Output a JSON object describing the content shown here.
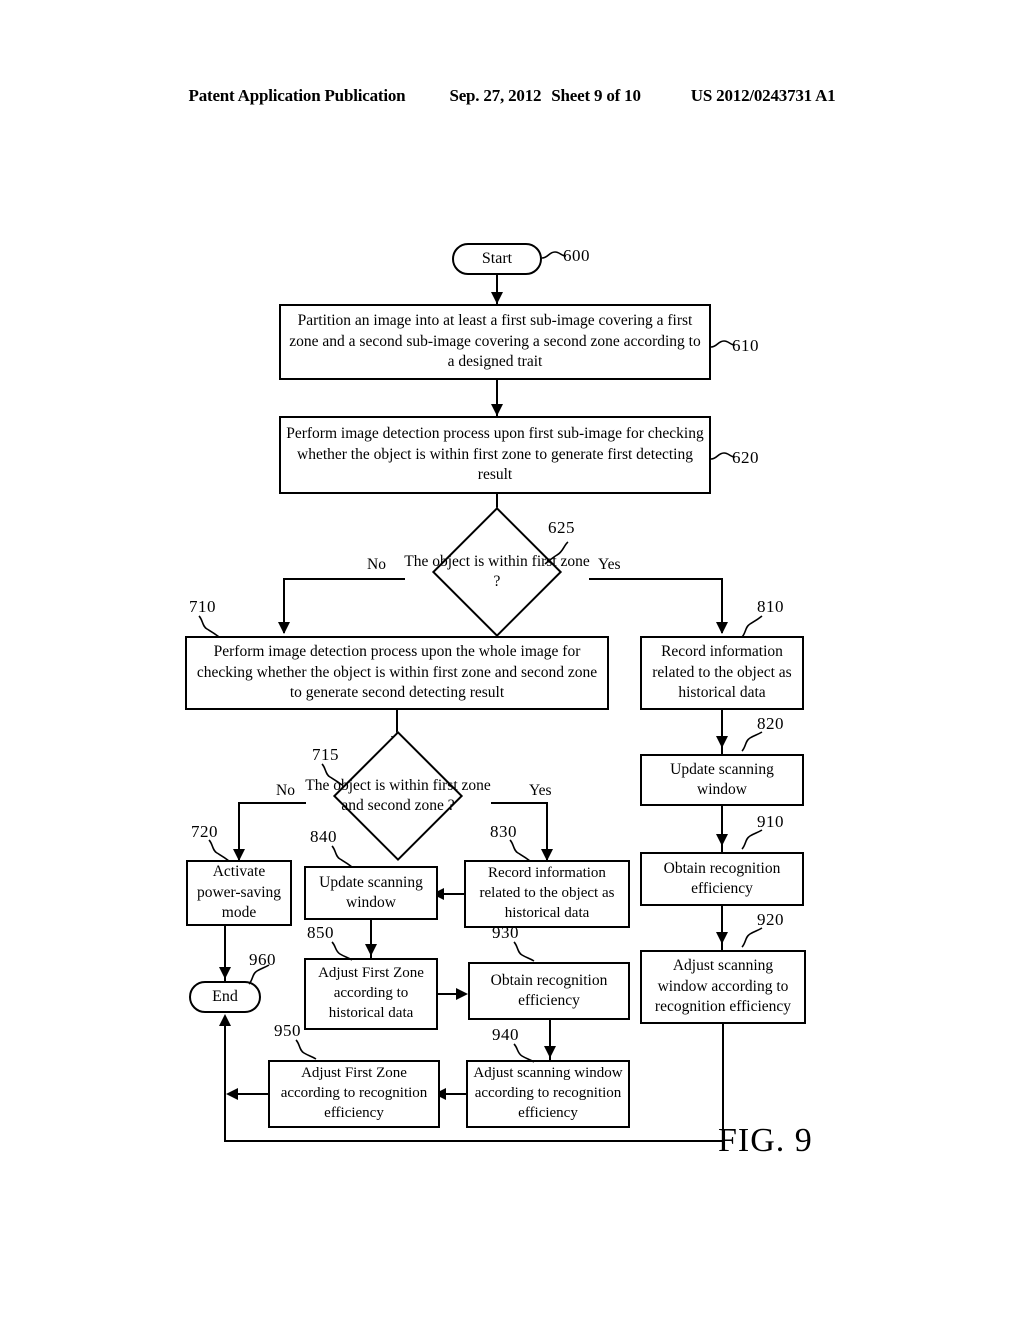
{
  "header": {
    "publication": "Patent Application Publication",
    "date": "Sep. 27, 2012",
    "sheet": "Sheet 9 of 10",
    "number": "US 2012/0243731 A1"
  },
  "figure": {
    "caption": "FIG. 9"
  },
  "nodes": {
    "start": {
      "label": "Start",
      "ref": "600"
    },
    "n610": {
      "label": "Partition an image into at least a first sub-image covering a first zone and a second sub-image covering a second zone according to a designed trait",
      "ref": "610"
    },
    "n620": {
      "label": "Perform image detection process upon first sub-image for checking whether the object is within first zone to generate first detecting result",
      "ref": "620"
    },
    "d625": {
      "label": "The object is within first zone ?",
      "ref": "625",
      "yes": "Yes",
      "no": "No"
    },
    "n710": {
      "label": "Perform image detection process upon the whole image for checking whether the object is within first zone and second zone to generate second detecting result",
      "ref": "710"
    },
    "n810": {
      "label": "Record information related to the object as historical data",
      "ref": "810"
    },
    "n820": {
      "label": "Update scanning window",
      "ref": "820"
    },
    "n910": {
      "label": "Obtain recognition efficiency",
      "ref": "910"
    },
    "n920": {
      "label": "Adjust scanning window according to recognition efficiency",
      "ref": "920"
    },
    "d715": {
      "label": "The object is within first zone and second zone ?",
      "ref": "715",
      "yes": "Yes",
      "no": "No"
    },
    "n720": {
      "label": "Activate power-saving mode",
      "ref": "720"
    },
    "n830": {
      "label": "Record information related to the object as historical data",
      "ref": "830"
    },
    "n840": {
      "label": "Update scanning window",
      "ref": "840"
    },
    "n850": {
      "label": "Adjust First Zone according to historical data",
      "ref": "850"
    },
    "n930": {
      "label": "Obtain recognition efficiency",
      "ref": "930"
    },
    "n940": {
      "label": "Adjust scanning window according to recognition efficiency",
      "ref": "940"
    },
    "n950": {
      "label": "Adjust First Zone according to recognition efficiency",
      "ref": "950"
    },
    "end": {
      "label": "End",
      "ref": "960"
    }
  },
  "chart_data": {
    "type": "diagram",
    "title": "FIG. 9",
    "diagram_kind": "flowchart",
    "steps": [
      {
        "id": "600",
        "shape": "terminal",
        "text": "Start"
      },
      {
        "id": "610",
        "shape": "process",
        "text": "Partition an image into at least a first sub-image covering a first zone and a second sub-image covering a second zone according to a designed trait"
      },
      {
        "id": "620",
        "shape": "process",
        "text": "Perform image detection process upon first sub-image for checking whether the object is within first zone to generate first detecting result"
      },
      {
        "id": "625",
        "shape": "decision",
        "text": "The object is within first zone ?"
      },
      {
        "id": "710",
        "shape": "process",
        "text": "Perform image detection process upon the whole image for checking whether the object is within first zone and second zone to generate second detecting result"
      },
      {
        "id": "810",
        "shape": "process",
        "text": "Record information related to the object as historical data"
      },
      {
        "id": "820",
        "shape": "process",
        "text": "Update scanning window"
      },
      {
        "id": "910",
        "shape": "process",
        "text": "Obtain recognition efficiency"
      },
      {
        "id": "920",
        "shape": "process",
        "text": "Adjust scanning window according to recognition efficiency"
      },
      {
        "id": "715",
        "shape": "decision",
        "text": "The object is within first zone and second zone ?"
      },
      {
        "id": "720",
        "shape": "process",
        "text": "Activate power-saving mode"
      },
      {
        "id": "830",
        "shape": "process",
        "text": "Record information related to the object as historical data"
      },
      {
        "id": "840",
        "shape": "process",
        "text": "Update scanning window"
      },
      {
        "id": "850",
        "shape": "process",
        "text": "Adjust First Zone according to historical data"
      },
      {
        "id": "930",
        "shape": "process",
        "text": "Obtain recognition efficiency"
      },
      {
        "id": "940",
        "shape": "process",
        "text": "Adjust scanning window according to recognition efficiency"
      },
      {
        "id": "950",
        "shape": "process",
        "text": "Adjust First Zone according to recognition efficiency"
      },
      {
        "id": "960",
        "shape": "terminal",
        "text": "End"
      }
    ],
    "edges": [
      {
        "from": "600",
        "to": "610",
        "label": ""
      },
      {
        "from": "610",
        "to": "620",
        "label": ""
      },
      {
        "from": "620",
        "to": "625",
        "label": ""
      },
      {
        "from": "625",
        "to": "710",
        "label": "No"
      },
      {
        "from": "625",
        "to": "810",
        "label": "Yes"
      },
      {
        "from": "710",
        "to": "715",
        "label": ""
      },
      {
        "from": "715",
        "to": "720",
        "label": "No"
      },
      {
        "from": "715",
        "to": "830",
        "label": "Yes"
      },
      {
        "from": "830",
        "to": "840",
        "label": ""
      },
      {
        "from": "840",
        "to": "850",
        "label": ""
      },
      {
        "from": "850",
        "to": "930",
        "label": ""
      },
      {
        "from": "930",
        "to": "940",
        "label": ""
      },
      {
        "from": "940",
        "to": "950",
        "label": ""
      },
      {
        "from": "950",
        "to": "960",
        "label": ""
      },
      {
        "from": "720",
        "to": "960",
        "label": ""
      },
      {
        "from": "810",
        "to": "820",
        "label": ""
      },
      {
        "from": "820",
        "to": "910",
        "label": ""
      },
      {
        "from": "910",
        "to": "920",
        "label": ""
      },
      {
        "from": "920",
        "to": "960",
        "label": ""
      }
    ]
  }
}
